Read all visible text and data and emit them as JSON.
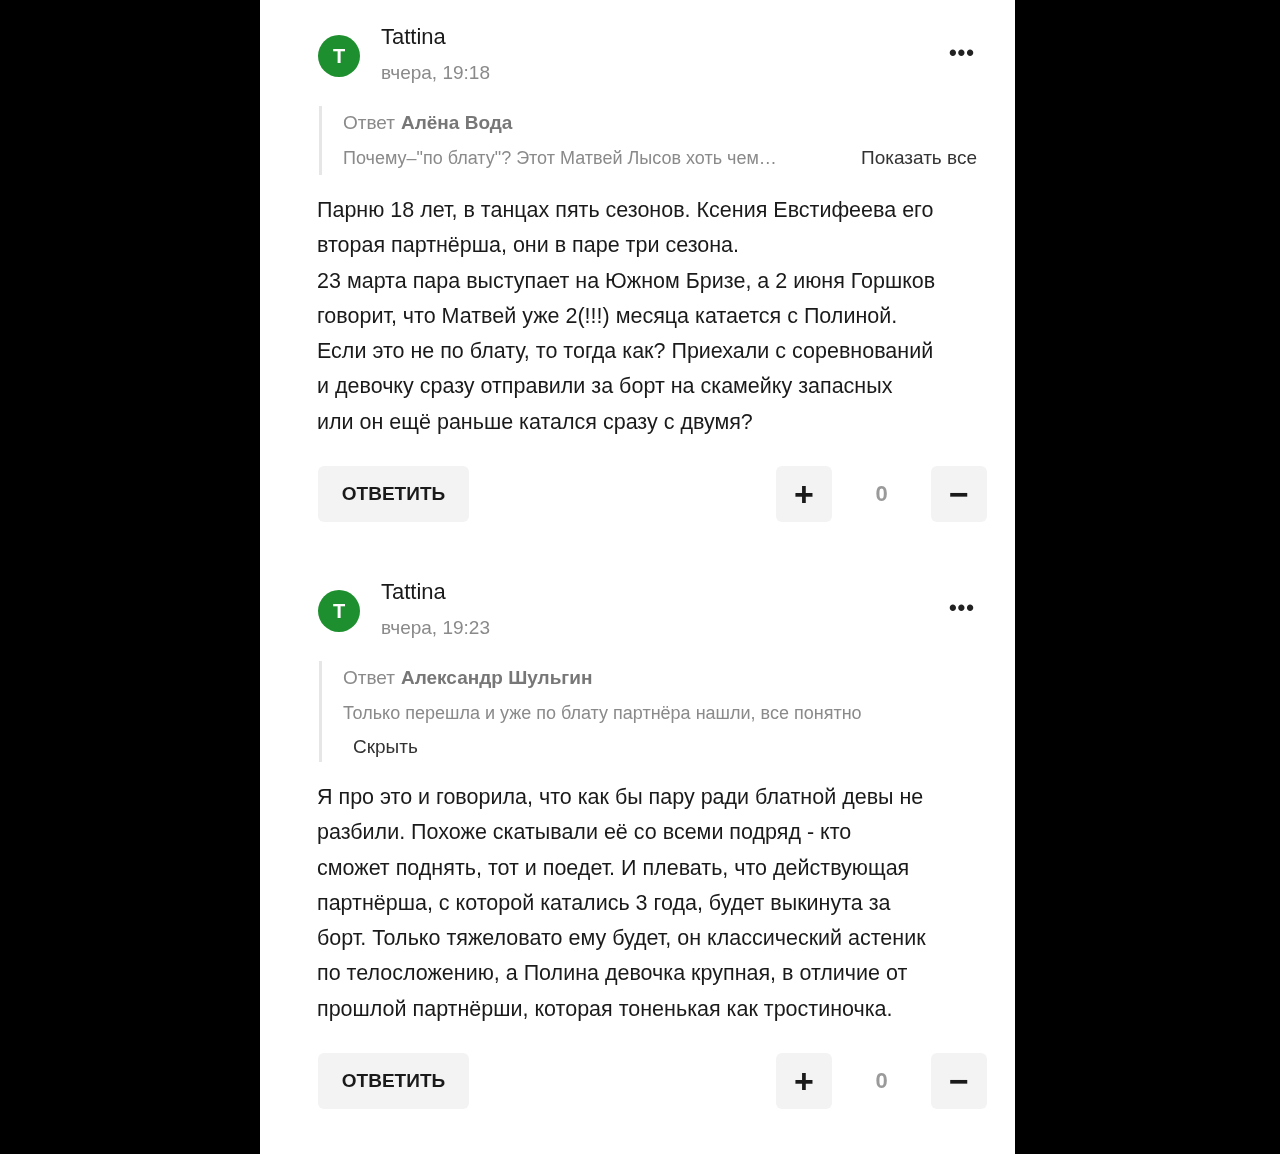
{
  "comments": [
    {
      "avatar_letter": "T",
      "author": "Tattina",
      "time": "вчера, 19:18",
      "menu": "•••",
      "quote": {
        "prefix": "Ответ",
        "author": "Алёна Вода",
        "text": "Почему–\"по блату\"? Этот Матвей Лысов хоть чем…",
        "expanded": false,
        "toggle": "Показать все"
      },
      "lines": [
        "Парню 18 лет, в танцах пять сезонов. Ксения Евстифеева его",
        "вторая партнёрша, они в паре три сезона.",
        "23 марта пара выступает на Южном Бризе, а 2 июня Горшков",
        "говорит, что Матвей уже 2(!!!) месяца катается с Полиной.",
        "Если это не по блату, то тогда как? Приехали с соревнований",
        "и девочку сразу отправили за борт на скамейку запасных",
        "или он ещё раньше катался сразу с двумя?"
      ],
      "reply": "ОТВЕТИТЬ",
      "plus": "+",
      "score": "0",
      "minus": "−"
    },
    {
      "avatar_letter": "T",
      "author": "Tattina",
      "time": "вчера, 19:23",
      "menu": "•••",
      "quote": {
        "prefix": "Ответ",
        "author": "Александр Шульгин",
        "text": "Только перешла и уже по блату партнёра нашли, все понятно",
        "expanded": true,
        "toggle": "Скрыть"
      },
      "lines": [
        "Я про это и говорила, что как бы пару ради блатной девы не",
        "разбили. Похоже скатывали её со всеми подряд - кто",
        "сможет поднять, тот и поедет. И плевать, что действующая",
        "партнёрша, с которой катались 3 года, будет выкинута за",
        "борт. Только тяжеловато ему будет, он классический астеник",
        "по телосложению, а Полина девочка крупная, в отличие от",
        "прошлой партнёрши, которая тоненькая как тростиночка."
      ],
      "reply": "ОТВЕТИТЬ",
      "plus": "+",
      "score": "0",
      "minus": "−"
    }
  ]
}
